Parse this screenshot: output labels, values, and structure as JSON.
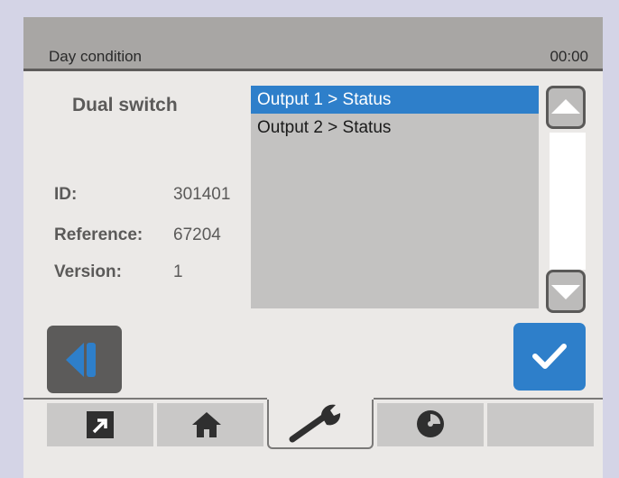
{
  "header": {
    "title": "Day condition",
    "clock": "00:00"
  },
  "device": {
    "name": "Dual switch",
    "info": [
      {
        "label": "ID:",
        "value": "301401"
      },
      {
        "label": "Reference:",
        "value": "67204"
      },
      {
        "label": "Version:",
        "value": "1"
      }
    ]
  },
  "list": {
    "items": [
      {
        "label": "Output 1 > Status",
        "selected": true
      },
      {
        "label": "Output 2 > Status",
        "selected": false
      }
    ]
  },
  "icons": {
    "scroll_up": "triangle-up-icon",
    "scroll_down": "triangle-down-icon",
    "back": "back-icon",
    "confirm": "checkmark-icon"
  },
  "tabs": [
    {
      "icon": "arrow-out-icon",
      "active": false
    },
    {
      "icon": "home-icon",
      "active": false
    },
    {
      "icon": "wrench-icon",
      "active": true
    },
    {
      "icon": "disc-icon",
      "active": false
    },
    {
      "icon": "",
      "active": false
    }
  ],
  "colors": {
    "accent": "#2e7fca",
    "titlebar": "#a8a6a4",
    "background": "#ebe9e7",
    "list_bg": "#c3c2c1"
  }
}
